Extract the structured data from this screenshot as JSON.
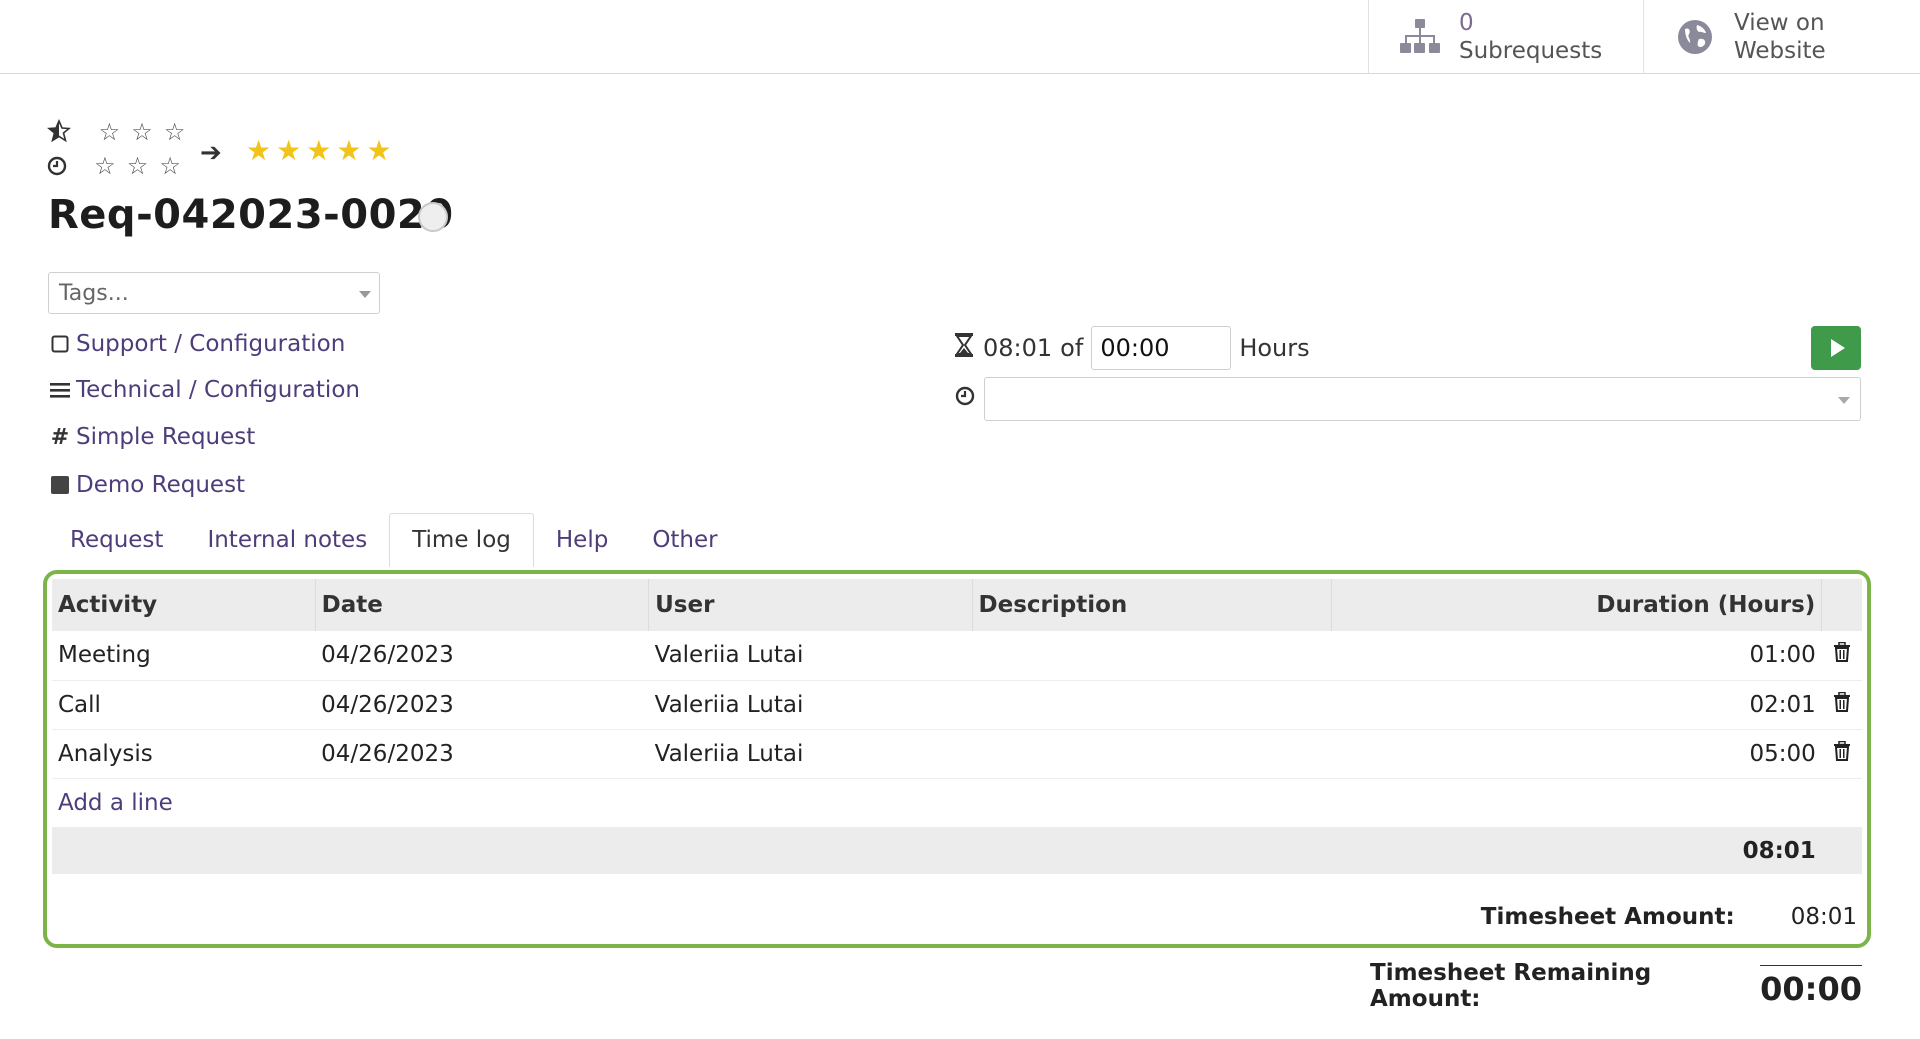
{
  "smart_buttons": {
    "subrequests": {
      "count": "0",
      "label": "Subrequests",
      "icon": "sitemap-icon"
    },
    "website": {
      "line1": "View on",
      "line2": "Website",
      "icon": "globe-icon"
    }
  },
  "priority": {
    "current_icon": "half-star-icon",
    "deadline_icon": "clock-icon",
    "target_stars": 5
  },
  "title": "Req-042023-0020",
  "tags": {
    "placeholder": "Tags..."
  },
  "info": {
    "category": "Support / Configuration",
    "service": "Technical / Configuration",
    "type": "Simple Request",
    "kind": "Demo Request"
  },
  "timer": {
    "elapsed": "08:01",
    "of_label": "of",
    "planned": "00:00",
    "unit": "Hours"
  },
  "tabs": [
    "Request",
    "Internal notes",
    "Time log",
    "Help",
    "Other"
  ],
  "active_tab": "Time log",
  "timelog": {
    "columns": [
      "Activity",
      "Date",
      "User",
      "Description",
      "Duration (Hours)"
    ],
    "rows": [
      {
        "activity": "Meeting",
        "date": "04/26/2023",
        "user": "Valeriia Lutai",
        "description": "",
        "duration": "01:00"
      },
      {
        "activity": "Call",
        "date": "04/26/2023",
        "user": "Valeriia Lutai",
        "description": "",
        "duration": "02:01"
      },
      {
        "activity": "Analysis",
        "date": "04/26/2023",
        "user": "Valeriia Lutai",
        "description": "",
        "duration": "05:00"
      }
    ],
    "add_line": "Add a line",
    "total": "08:01"
  },
  "timesheet": {
    "amount_label": "Timesheet Amount:",
    "amount": "08:01",
    "remaining_label": "Timesheet Remaining Amount:",
    "remaining": "00:00"
  },
  "colors": {
    "accent": "#4e3d7a",
    "highlight_border": "#7bb54a",
    "play": "#3f9a4a",
    "star": "#f0c419"
  }
}
